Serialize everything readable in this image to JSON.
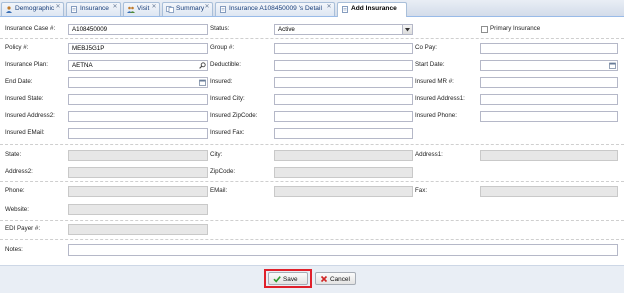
{
  "tabs": [
    {
      "label": "Demographic",
      "icon": "user-icon"
    },
    {
      "label": "Insurance",
      "icon": "document-icon"
    },
    {
      "label": "Visit",
      "icon": "people-icon"
    },
    {
      "label": "Summary",
      "icon": "pages-icon"
    },
    {
      "label": "Insurance A108450009 's Detail",
      "icon": "document-icon"
    },
    {
      "label": "Add Insurance",
      "icon": "document-icon"
    }
  ],
  "form": {
    "insurance_case": {
      "label": "Insurance Case #:",
      "value": "A108450009"
    },
    "status": {
      "label": "Status:",
      "value": "Active"
    },
    "primary_insurance": {
      "label": "Primary Insurance",
      "checked": false
    },
    "policy": {
      "label": "Policy #:",
      "value": "MEBJ5G1P"
    },
    "group": {
      "label": "Group #:",
      "value": ""
    },
    "co_pay": {
      "label": "Co Pay:",
      "value": ""
    },
    "insurance_plan": {
      "label": "Insurance Plan:",
      "value": "AETNA"
    },
    "deductible": {
      "label": "Deductible:",
      "value": ""
    },
    "start_date": {
      "label": "Start Date:",
      "value": ""
    },
    "end_date": {
      "label": "End Date:",
      "value": ""
    },
    "insured": {
      "label": "Insured:",
      "value": ""
    },
    "insured_mr": {
      "label": "Insured MR #:",
      "value": ""
    },
    "insured_state": {
      "label": "Insured State:",
      "value": ""
    },
    "insured_city": {
      "label": "Insured City:",
      "value": ""
    },
    "insured_address1": {
      "label": "Insured Address1:",
      "value": ""
    },
    "insured_address2": {
      "label": "Insured Address2:",
      "value": ""
    },
    "insured_zipcode": {
      "label": "Insured ZipCode:",
      "value": ""
    },
    "insured_phone": {
      "label": "Insured Phone:",
      "value": ""
    },
    "insured_email": {
      "label": "Insured EMail:",
      "value": ""
    },
    "insured_fax": {
      "label": "Insured Fax:",
      "value": ""
    },
    "state": {
      "label": "State:",
      "value": ""
    },
    "city": {
      "label": "City:",
      "value": ""
    },
    "address1": {
      "label": "Address1:",
      "value": ""
    },
    "address2": {
      "label": "Address2:",
      "value": ""
    },
    "zipcode": {
      "label": "ZipCode:",
      "value": ""
    },
    "phone": {
      "label": "Phone:",
      "value": ""
    },
    "email": {
      "label": "EMail:",
      "value": ""
    },
    "fax": {
      "label": "Fax:",
      "value": ""
    },
    "website": {
      "label": "Website:",
      "value": ""
    },
    "edi_payer": {
      "label": "EDI Payer #:",
      "value": ""
    },
    "notes": {
      "label": "Notes:",
      "value": ""
    }
  },
  "footer": {
    "save_label": "Save",
    "cancel_label": "Cancel"
  },
  "colors": {
    "tab_border": "#99bbe8",
    "highlight": "#e0202a",
    "readonly_fill": "#e7e7e7"
  }
}
